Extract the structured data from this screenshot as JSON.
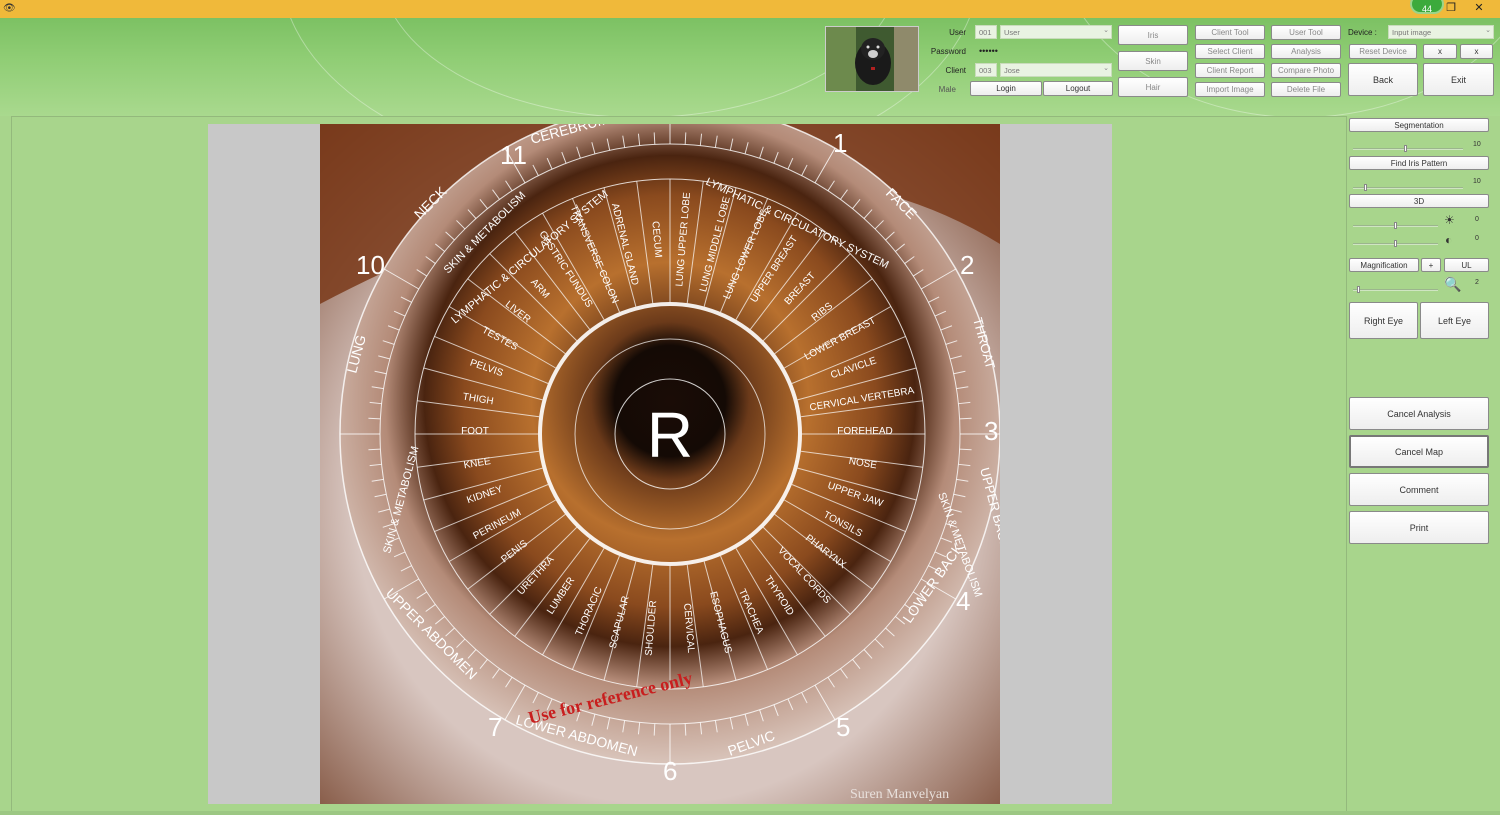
{
  "window": {
    "app_icon": "eye-icon",
    "badge": "44",
    "restore_glyph": "❐",
    "close_glyph": "✕"
  },
  "login": {
    "user_label": "User",
    "user_id": "001",
    "user_name": "User",
    "password_label": "Password",
    "password_value": "••••••",
    "client_label": "Client",
    "client_id": "003",
    "client_name": "Jose",
    "gender": "Male",
    "login_button": "Login",
    "logout_button": "Logout"
  },
  "modes": {
    "iris": "Iris",
    "skin": "Skin",
    "hair": "Hair"
  },
  "tools": {
    "client_tool": "Client Tool",
    "select_client": "Select Client",
    "client_report": "Client Report",
    "import_image": "Import Image",
    "user_tool": "User Tool",
    "analysis": "Analysis",
    "compare_photo": "Compare Photo",
    "delete_file": "Delete File"
  },
  "device": {
    "label": "Device :",
    "value": "Input image",
    "reset": "Reset Device",
    "x1": "x",
    "x2": "x",
    "back": "Back",
    "exit": "Exit"
  },
  "panel": {
    "segmentation": "Segmentation",
    "segmentation_value": "10",
    "find_pattern": "Find Iris Pattern",
    "find_pattern_value": "10",
    "three_d": "3D",
    "brightness_value": "0",
    "contrast_value": "0",
    "magnification": "Magnification",
    "plus": "+",
    "ul": "UL",
    "magnification_value": "2",
    "right_eye": "Right Eye",
    "left_eye": "Left Eye",
    "cancel_analysis": "Cancel Analysis",
    "cancel_map": "Cancel Map",
    "comment": "Comment",
    "print": "Print"
  },
  "iris_chart": {
    "center_letter": "R",
    "watermark": "Use for reference only",
    "signature": "Suren Manvelyan",
    "hours": [
      "1",
      "2",
      "3",
      "4",
      "5",
      "6",
      "7",
      "10",
      "11"
    ],
    "outer_labels": [
      "NECK",
      "CEREBRUM",
      "FACE",
      "THROAT",
      "UPPER BACK",
      "LOWER BACK",
      "PELVIC",
      "LOWER ABDOMEN",
      "UPPER ABDOMEN",
      "LUNG"
    ],
    "ring_label": "SKIN & METABOLISM",
    "circ_label": "LYMPHATIC & CIRCULATORY SYSTEM",
    "zones": [
      "LUNG UPPER LOBE",
      "LUNG MIDDLE LOBE",
      "LUNG LOWER LOBE",
      "UPPER BREAST",
      "BREAST",
      "RIBS",
      "LOWER BREAST",
      "CLAVICLE",
      "CERVICAL VERTEBRA",
      "FOREHEAD",
      "NOSE",
      "UPPER JAW",
      "TONSILS",
      "PHARYNX",
      "VOCAL CORDS",
      "THYROID",
      "TRACHEA",
      "ESOPHAGUS",
      "CERVICAL",
      "SHOULDER",
      "SCAPULAR",
      "THORACIC",
      "LUMBER",
      "URETHRA",
      "PENIS",
      "PERINEUM",
      "KIDNEY",
      "KNEE",
      "FOOT",
      "THIGH",
      "PELVIS",
      "TESTES",
      "LIVER",
      "ARM",
      "GASTRIC FUNDUS",
      "TRANSVERSE COLON",
      "ADRENAL GLAND",
      "CECUM"
    ]
  }
}
